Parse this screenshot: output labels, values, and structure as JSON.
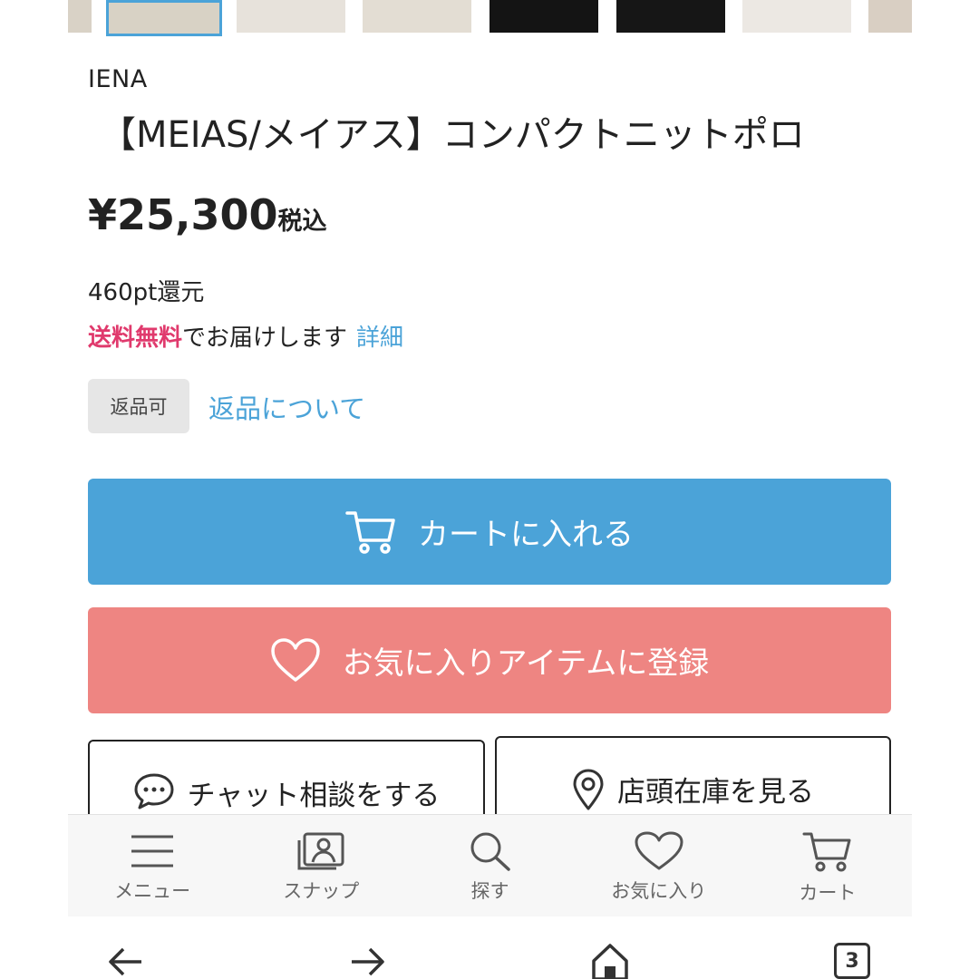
{
  "product": {
    "brand": "IENA",
    "title": "【MEIAS/メイアス】コンパクトニットポロ",
    "price": "¥25,300",
    "tax_label": "税込",
    "points": "460pt還元",
    "shipping_free": "送料無料",
    "shipping_text": "でお届けします",
    "shipping_detail": "詳細",
    "return_badge": "返品可",
    "return_link": "返品について"
  },
  "actions": {
    "add_to_cart": "カートに入れる",
    "add_to_favorites": "お気に入りアイテムに登録",
    "chat": "チャット相談をする",
    "store_stock": "店頭在庫を見る"
  },
  "tabbar": {
    "items": [
      {
        "label": "メニュー",
        "icon": "menu-icon"
      },
      {
        "label": "スナップ",
        "icon": "snap-icon"
      },
      {
        "label": "探す",
        "icon": "search-icon"
      },
      {
        "label": "お気に入り",
        "icon": "heart-icon"
      },
      {
        "label": "カート",
        "icon": "cart-icon"
      }
    ]
  },
  "browser": {
    "tab_count": "3"
  },
  "colors": {
    "accent_blue": "#4ba3d8",
    "favorite_pink": "#ee8582",
    "free_shipping": "#e03a6d"
  }
}
